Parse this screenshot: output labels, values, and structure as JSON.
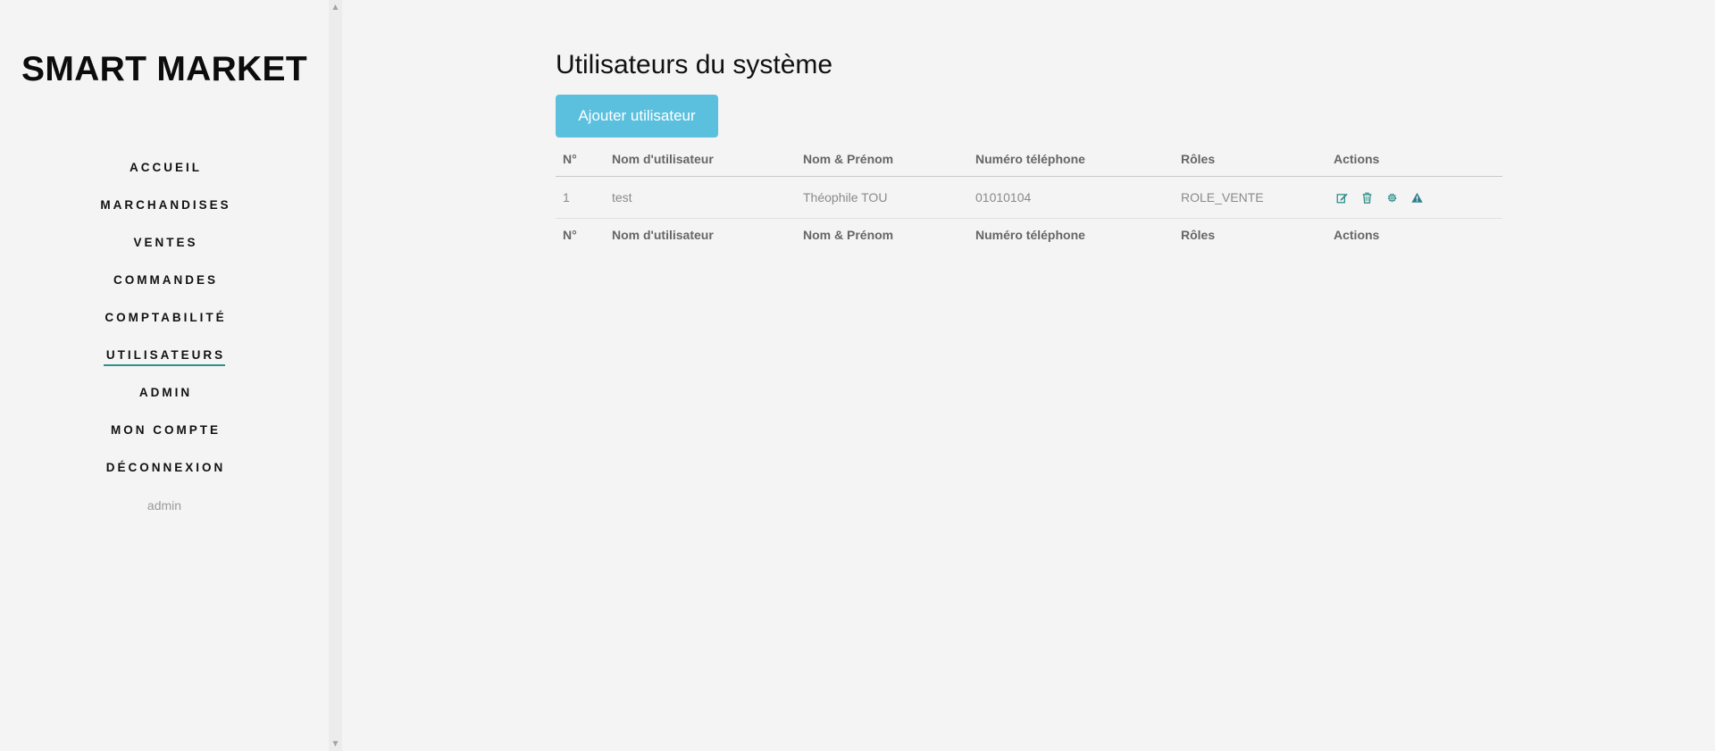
{
  "sidebar": {
    "brand": "SMART MARKET",
    "items": [
      {
        "label": "ACCUEIL"
      },
      {
        "label": "MARCHANDISES"
      },
      {
        "label": "VENTES"
      },
      {
        "label": "COMMANDES"
      },
      {
        "label": "COMPTABILITÉ"
      },
      {
        "label": "UTILISATEURS"
      },
      {
        "label": "ADMIN"
      },
      {
        "label": "MON COMPTE"
      },
      {
        "label": "DÉCONNEXION"
      }
    ],
    "active_item": "UTILISATEURS",
    "current_user": "admin"
  },
  "main": {
    "title": "Utilisateurs du système",
    "add_button_label": "Ajouter utilisateur",
    "table": {
      "columns": [
        "N°",
        "Nom d'utilisateur",
        "Nom & Prénom",
        "Numéro téléphone",
        "Rôles",
        "Actions"
      ],
      "rows": [
        {
          "number": "1",
          "username": "test",
          "fullname": "Théophile TOU",
          "phone": "01010104",
          "role": "ROLE_VENTE",
          "actions": [
            "edit-icon",
            "trash-icon",
            "gear-icon",
            "warning-icon"
          ]
        }
      ]
    }
  },
  "colors": {
    "accent": "#2f8f8a",
    "button": "#5bc0de",
    "background": "#f4f4f4"
  }
}
